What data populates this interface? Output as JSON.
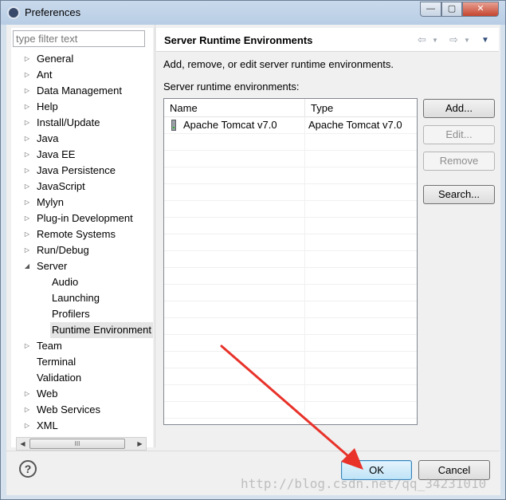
{
  "window": {
    "title": "Preferences",
    "controls": {
      "minimize": "—",
      "maximize": "▢",
      "close": "✕"
    }
  },
  "filter": {
    "placeholder": "type filter text",
    "value": ""
  },
  "tree": {
    "items": [
      {
        "label": "General",
        "expanded": false,
        "level": 0,
        "arrow": "▷"
      },
      {
        "label": "Ant",
        "expanded": false,
        "level": 0,
        "arrow": "▷"
      },
      {
        "label": "Data Management",
        "expanded": false,
        "level": 0,
        "arrow": "▷"
      },
      {
        "label": "Help",
        "expanded": false,
        "level": 0,
        "arrow": "▷"
      },
      {
        "label": "Install/Update",
        "expanded": false,
        "level": 0,
        "arrow": "▷"
      },
      {
        "label": "Java",
        "expanded": false,
        "level": 0,
        "arrow": "▷"
      },
      {
        "label": "Java EE",
        "expanded": false,
        "level": 0,
        "arrow": "▷"
      },
      {
        "label": "Java Persistence",
        "expanded": false,
        "level": 0,
        "arrow": "▷"
      },
      {
        "label": "JavaScript",
        "expanded": false,
        "level": 0,
        "arrow": "▷"
      },
      {
        "label": "Mylyn",
        "expanded": false,
        "level": 0,
        "arrow": "▷"
      },
      {
        "label": "Plug-in Development",
        "expanded": false,
        "level": 0,
        "arrow": "▷"
      },
      {
        "label": "Remote Systems",
        "expanded": false,
        "level": 0,
        "arrow": "▷"
      },
      {
        "label": "Run/Debug",
        "expanded": false,
        "level": 0,
        "arrow": "▷"
      },
      {
        "label": "Server",
        "expanded": true,
        "level": 0,
        "arrow": "◢"
      },
      {
        "label": "Audio",
        "level": 1,
        "arrow": ""
      },
      {
        "label": "Launching",
        "level": 1,
        "arrow": ""
      },
      {
        "label": "Profilers",
        "level": 1,
        "arrow": ""
      },
      {
        "label": "Runtime Environment",
        "level": 1,
        "arrow": "",
        "selected": true
      },
      {
        "label": "Team",
        "expanded": false,
        "level": 0,
        "arrow": "▷"
      },
      {
        "label": "Terminal",
        "level": 0,
        "arrow": ""
      },
      {
        "label": "Validation",
        "level": 0,
        "arrow": ""
      },
      {
        "label": "Web",
        "expanded": false,
        "level": 0,
        "arrow": "▷"
      },
      {
        "label": "Web Services",
        "expanded": false,
        "level": 0,
        "arrow": "▷"
      },
      {
        "label": "XML",
        "expanded": false,
        "level": 0,
        "arrow": "▷"
      }
    ],
    "scroll_left": "◀",
    "scroll_right": "▶",
    "scroll_grip": "III"
  },
  "page": {
    "title": "Server Runtime Environments",
    "nav_back": "⇦",
    "nav_forward": "⇨",
    "nav_dropdown": "▼",
    "nav_menu": "▼",
    "description": "Add, remove, or edit server runtime environments.",
    "list_label": "Server runtime environments:",
    "table": {
      "columns": [
        "Name",
        "Type"
      ],
      "rows": [
        {
          "name": "Apache Tomcat v7.0",
          "type": "Apache Tomcat v7.0"
        }
      ],
      "empty_row_count": 17
    },
    "buttons": {
      "add": "Add...",
      "edit": "Edit...",
      "remove": "Remove",
      "search": "Search..."
    }
  },
  "footer": {
    "help": "?",
    "ok": "OK",
    "cancel": "Cancel"
  },
  "watermark": "http://blog.csdn.net/qq_34231010",
  "colors": {
    "annotation_arrow": "#e8322a",
    "ok_highlight": "#bfe3f7",
    "selection": "#e5e5e5"
  }
}
